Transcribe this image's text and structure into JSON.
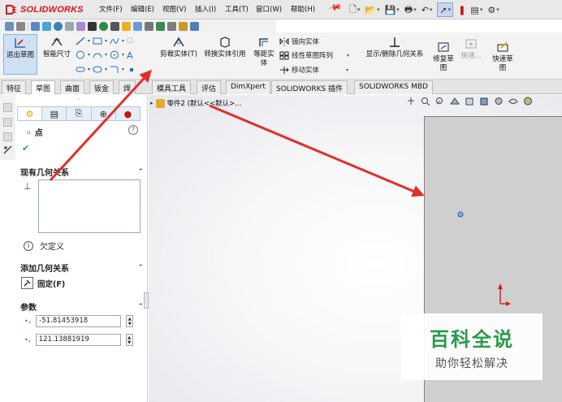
{
  "app": {
    "brand": "SOLIDWORKS",
    "menu": [
      "文件(F)",
      "编辑(E)",
      "视图(V)",
      "插入(I)",
      "工具(T)",
      "窗口(W)",
      "帮助(H)"
    ]
  },
  "command_manager": {
    "exit_sketch": "退出草图",
    "smart_dimension": "智能尺寸",
    "trim_entities": "剪裁实体(T)",
    "convert_entities": "转换实体引用",
    "offset_entities": [
      "等距实",
      "体"
    ],
    "mirror_entities": "镜向实体",
    "linear_pattern": "线性草图阵列",
    "move_entities": "移动实体",
    "display_relations": "显示/删除几何关系",
    "repair_sketch": [
      "修复草",
      "图"
    ],
    "quick_snaps": "快速...",
    "rapid_sketch": [
      "快速草",
      "图"
    ]
  },
  "tabs": [
    "特征",
    "草图",
    "曲面",
    "钣金",
    "焊",
    "模具工具",
    "评估",
    "DimXpert",
    "SOLIDWORKS 插件",
    "SOLIDWORKS MBD"
  ],
  "active_tab": "草图",
  "property_manager": {
    "title": "点",
    "help": "?",
    "existing_relations": {
      "title": "现有几何关系",
      "status": "欠定义"
    },
    "add_relations": {
      "title": "添加几何关系",
      "fix": "固定(F)"
    },
    "parameters": {
      "title": "参数",
      "x_value": "-51.81453918",
      "y_value": "121.13881919"
    }
  },
  "feature_tree": {
    "root_label": "零件2 (默认<<默认>..."
  },
  "watermark": {
    "main": "百科全说",
    "sub": "助你轻松解决"
  },
  "colors": {
    "brand_red": "#d9141b",
    "arrow_red": "#e0302c",
    "watermark_green": "#2a9a4a"
  }
}
